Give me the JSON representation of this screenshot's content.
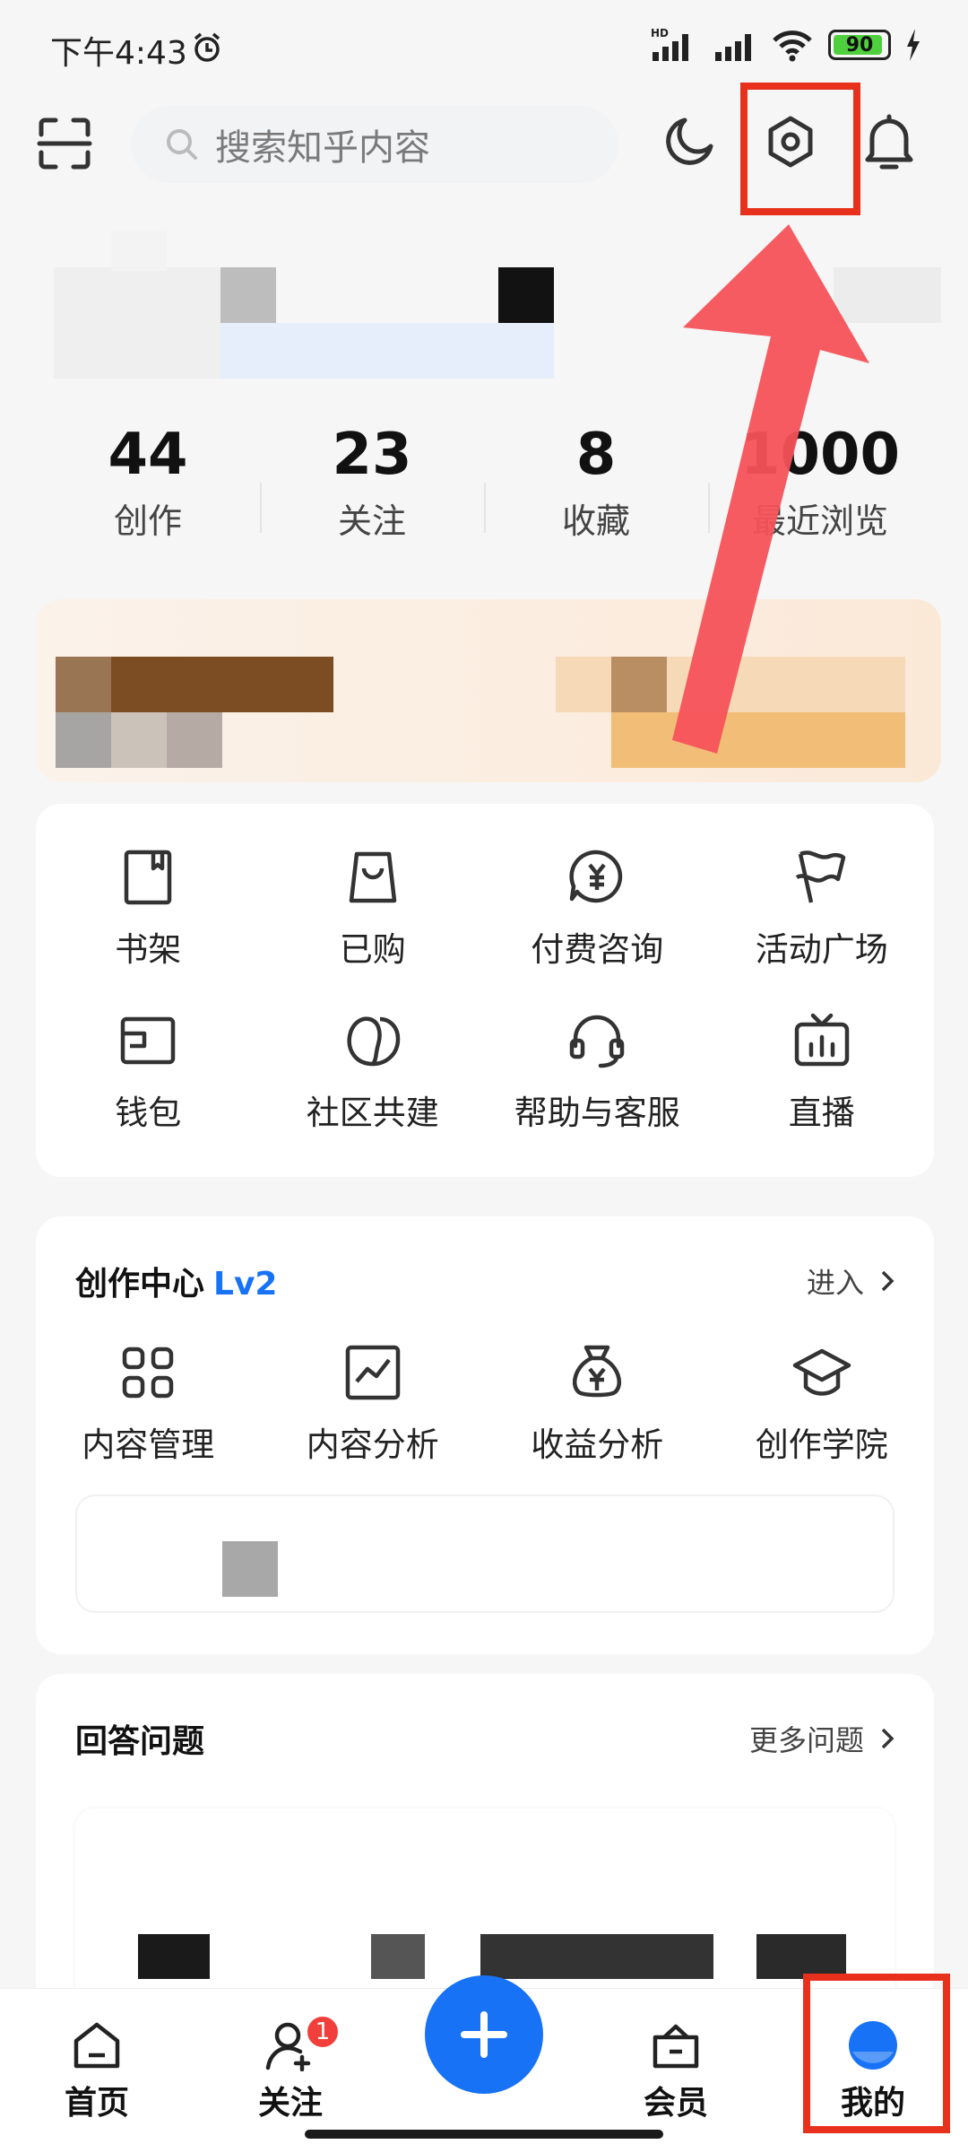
{
  "status_bar": {
    "time": "下午4:43",
    "battery": "90",
    "network": "HD"
  },
  "top_bar": {
    "search_placeholder": "搜索知乎内容",
    "icons": [
      "scan-icon",
      "night-mode-icon",
      "settings-icon",
      "bell-icon"
    ]
  },
  "stats": [
    {
      "value": "44",
      "label": "创作"
    },
    {
      "value": "23",
      "label": "关注"
    },
    {
      "value": "8",
      "label": "收藏"
    },
    {
      "value": "1000",
      "label": "最近浏览"
    }
  ],
  "tools": [
    {
      "label": "书架",
      "icon": "bookshelf-icon"
    },
    {
      "label": "已购",
      "icon": "shopping-bag-icon"
    },
    {
      "label": "付费咨询",
      "icon": "paid-consult-icon"
    },
    {
      "label": "活动广场",
      "icon": "flag-icon"
    },
    {
      "label": "钱包",
      "icon": "wallet-icon"
    },
    {
      "label": "社区共建",
      "icon": "community-icon"
    },
    {
      "label": "帮助与客服",
      "icon": "headset-icon"
    },
    {
      "label": "直播",
      "icon": "tv-icon"
    }
  ],
  "creation_center": {
    "title": "创作中心",
    "level": "Lv2",
    "enter": "进入",
    "items": [
      {
        "label": "内容管理",
        "icon": "grid-icon"
      },
      {
        "label": "内容分析",
        "icon": "chart-icon"
      },
      {
        "label": "收益分析",
        "icon": "money-bag-icon"
      },
      {
        "label": "创作学院",
        "icon": "graduation-cap-icon"
      }
    ]
  },
  "answer_questions": {
    "title": "回答问题",
    "more": "更多问题"
  },
  "bottom_nav": [
    {
      "label": "首页",
      "icon": "home-icon"
    },
    {
      "label": "关注",
      "icon": "follow-icon",
      "badge": "1"
    },
    {
      "label": "会员",
      "icon": "vip-icon"
    },
    {
      "label": "我的",
      "icon": "profile-icon"
    }
  ],
  "colors": {
    "accent": "#1772f6",
    "highlight": "#e8311c",
    "arrow": "#f5525a"
  }
}
